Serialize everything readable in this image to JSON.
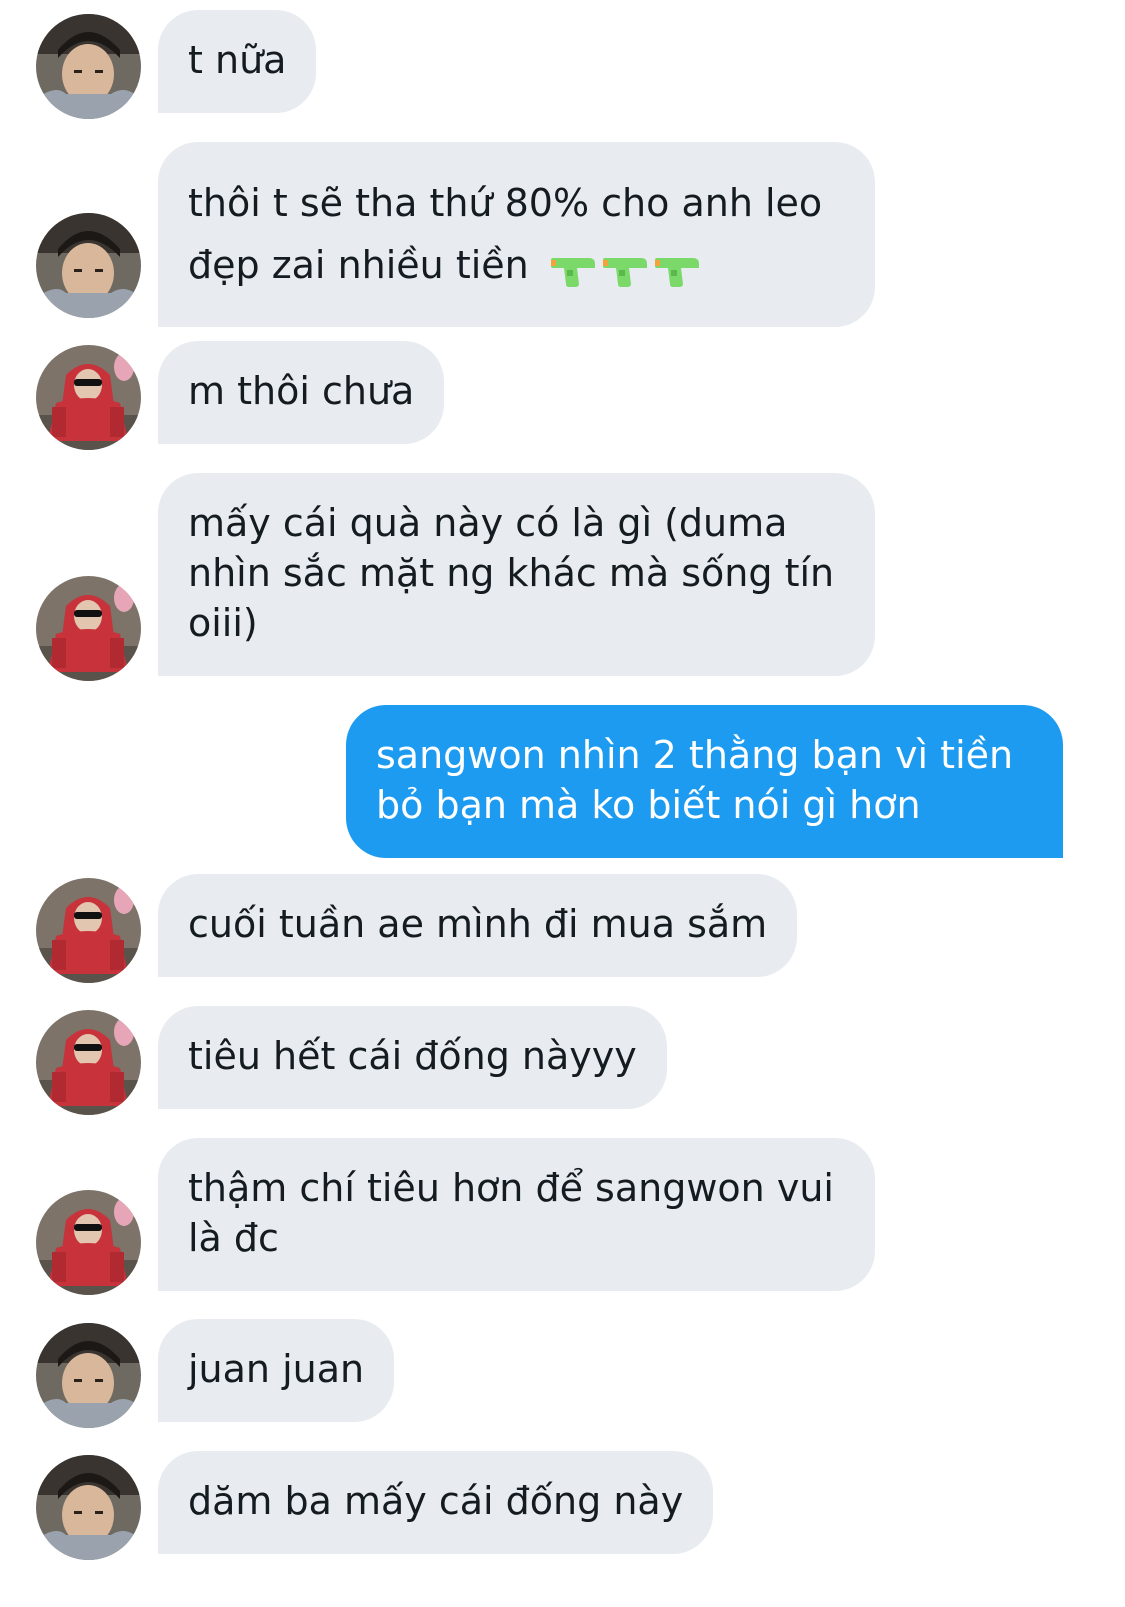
{
  "thread": {
    "messages": [
      {
        "sender": "contact-a",
        "lines": [
          "t nữa"
        ]
      },
      {
        "sender": "contact-a",
        "lines": [
          "thôi t sẽ tha thứ 80% cho anh leo",
          "đẹp zai nhiều tiền"
        ],
        "emoji": [
          "water-pistol-icon",
          "water-pistol-icon",
          "water-pistol-icon"
        ]
      },
      {
        "sender": "contact-b",
        "lines": [
          "m thôi chưa"
        ]
      },
      {
        "sender": "contact-b",
        "lines": [
          "mấy cái quà này có là gì (duma",
          "nhìn sắc mặt ng khác mà sống tín",
          "oiii)"
        ]
      },
      {
        "sender": "me",
        "lines": [
          "sangwon nhìn 2 thằng bạn vì tiền",
          "bỏ bạn mà ko biết nói gì hơn"
        ]
      },
      {
        "sender": "contact-b",
        "lines": [
          "cuối tuần ae mình đi mua sắm"
        ]
      },
      {
        "sender": "contact-b",
        "lines": [
          "tiêu hết cái đống nàyyy"
        ]
      },
      {
        "sender": "contact-b",
        "lines": [
          "thậm chí tiêu hơn để sangwon vui",
          "là đc"
        ]
      },
      {
        "sender": "contact-a",
        "lines": [
          "juan juan"
        ]
      },
      {
        "sender": "contact-a",
        "lines": [
          "dăm ba mấy cái đống này"
        ]
      }
    ]
  },
  "colors": {
    "incoming_bubble": "#e8ecf0",
    "outgoing_bubble": "#1d9bf0",
    "incoming_text": "#141b21",
    "outgoing_text": "#ffffff",
    "emoji_green": "#7bd96a"
  }
}
